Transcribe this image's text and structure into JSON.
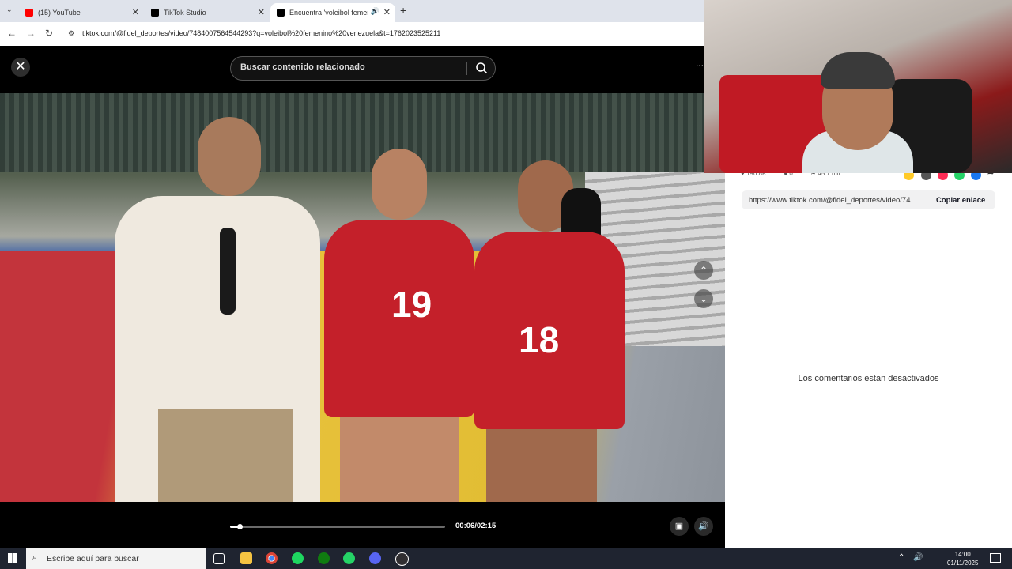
{
  "browser": {
    "tabs": [
      {
        "label": "(15) YouTube",
        "icon": "youtube-icon",
        "color": "#ff0000"
      },
      {
        "label": "TikTok Studio",
        "icon": "tiktok-icon",
        "color": "#000000"
      },
      {
        "label": "Encuentra 'voleibol femeni",
        "icon": "tiktok-icon",
        "color": "#000000"
      }
    ],
    "new_tab": "+",
    "url": "tiktok.com/@fidel_deportes/video/7484007564544293?q=voleibol%20femenino%20venezuela&t=1762023525211"
  },
  "tiktok": {
    "search_placeholder": "Buscar contenido relacionado",
    "time": "00:06/02:15",
    "progress": 0.044,
    "close": "✕",
    "stats": {
      "likes": "196.8K",
      "comments": "0",
      "saves": "45.7 mil"
    },
    "share_link": "https://www.tiktok.com/@fidel_deportes/video/74...",
    "copy_link": "Copiar enlace",
    "comments_disabled": "Los comentarios estan desactivados",
    "video_jersey_numbers": [
      "19",
      "18"
    ]
  },
  "taskbar": {
    "search_placeholder": "Escribe aquí para buscar",
    "time": "14:00",
    "date": "01/11/2025"
  }
}
